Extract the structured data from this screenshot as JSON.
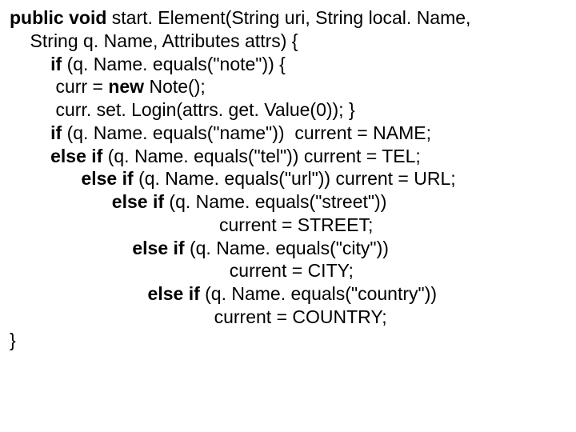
{
  "lines": [
    {
      "segments": [
        {
          "t": "public void ",
          "b": true
        },
        {
          "t": "start. Element(String uri, String local. Name,",
          "b": false
        }
      ]
    },
    {
      "segments": [
        {
          "t": "    String q. Name, Attributes attrs) {",
          "b": false
        }
      ]
    },
    {
      "segments": [
        {
          "t": "        if ",
          "b": true
        },
        {
          "t": "(q. Name. equals(\"note\")) {",
          "b": false
        }
      ]
    },
    {
      "segments": [
        {
          "t": "         curr = ",
          "b": false
        },
        {
          "t": "new ",
          "b": true
        },
        {
          "t": "Note();",
          "b": false
        }
      ]
    },
    {
      "segments": [
        {
          "t": "         curr. set. Login(attrs. get. Value(0)); }",
          "b": false
        }
      ]
    },
    {
      "segments": [
        {
          "t": "        if ",
          "b": true
        },
        {
          "t": "(q. Name. equals(\"name\"))  current = NAME;",
          "b": false
        }
      ]
    },
    {
      "segments": [
        {
          "t": "        else if ",
          "b": true
        },
        {
          "t": "(q. Name. equals(\"tel\")) current = TEL;",
          "b": false
        }
      ]
    },
    {
      "segments": [
        {
          "t": "              else if ",
          "b": true
        },
        {
          "t": "(q. Name. equals(\"url\")) current = URL;",
          "b": false
        }
      ]
    },
    {
      "segments": [
        {
          "t": "                    else if ",
          "b": true
        },
        {
          "t": "(q. Name. equals(\"street\"))",
          "b": false
        }
      ]
    },
    {
      "segments": [
        {
          "t": "                                         current = STREET;",
          "b": false
        }
      ]
    },
    {
      "segments": [
        {
          "t": "                        else if ",
          "b": true
        },
        {
          "t": "(q. Name. equals(\"city\"))",
          "b": false
        }
      ]
    },
    {
      "segments": [
        {
          "t": "                                           current = CITY;",
          "b": false
        }
      ]
    },
    {
      "segments": [
        {
          "t": "                           else if ",
          "b": true
        },
        {
          "t": "(q. Name. equals(\"country\"))",
          "b": false
        }
      ]
    },
    {
      "segments": [
        {
          "t": "                                        current = COUNTRY;",
          "b": false
        }
      ]
    },
    {
      "segments": [
        {
          "t": "}",
          "b": false
        }
      ]
    }
  ]
}
